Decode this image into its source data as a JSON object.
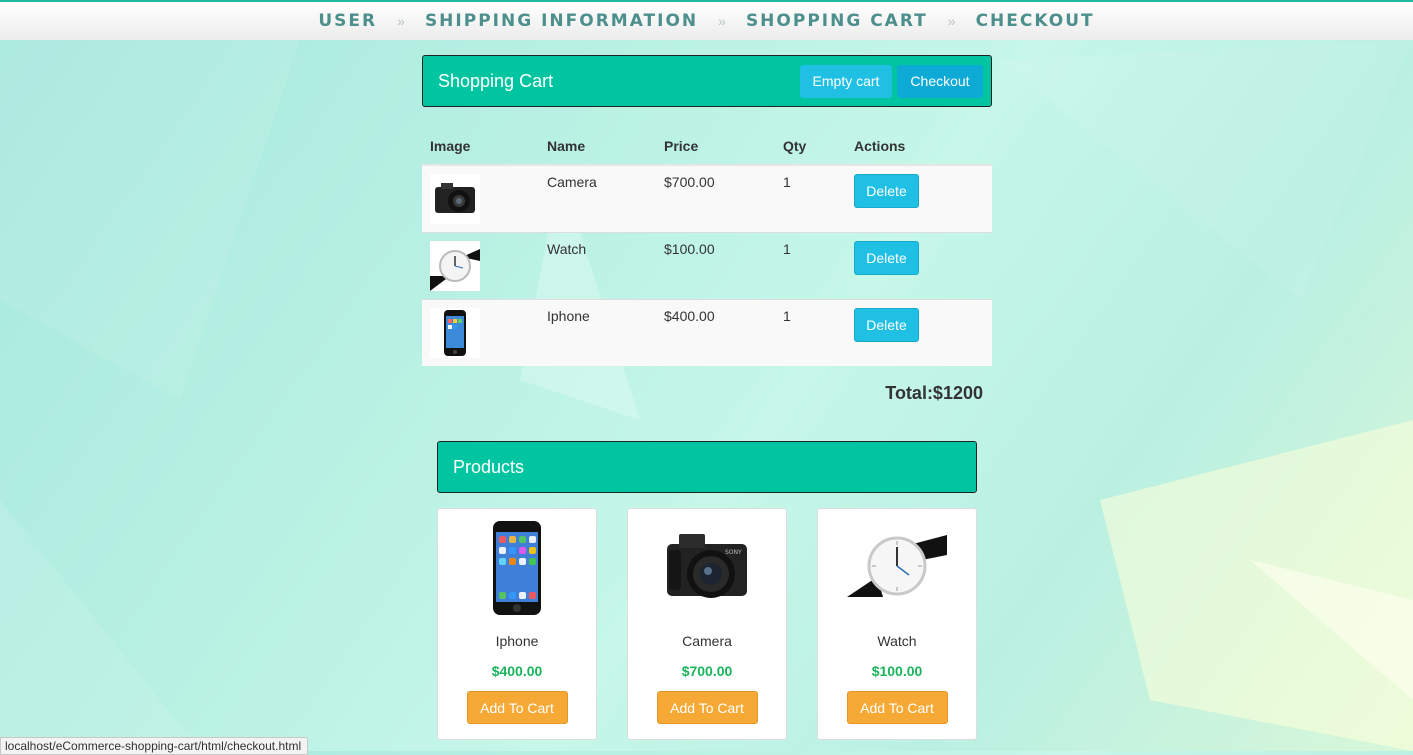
{
  "nav": {
    "items": [
      "USER",
      "SHIPPING INFORMATION",
      "SHOPPING CART",
      "CHECKOUT"
    ],
    "separator": "»"
  },
  "cart": {
    "title": "Shopping Cart",
    "empty_label": "Empty cart",
    "checkout_label": "Checkout",
    "columns": [
      "Image",
      "Name",
      "Price",
      "Qty",
      "Actions"
    ],
    "rows": [
      {
        "name": "Camera",
        "price": "$700.00",
        "qty": "1",
        "action": "Delete",
        "icon": "camera-icon"
      },
      {
        "name": "Watch",
        "price": "$100.00",
        "qty": "1",
        "action": "Delete",
        "icon": "watch-icon"
      },
      {
        "name": "Iphone",
        "price": "$400.00",
        "qty": "1",
        "action": "Delete",
        "icon": "phone-icon"
      }
    ],
    "total": "Total:$1200"
  },
  "products": {
    "title": "Products",
    "items": [
      {
        "name": "Iphone",
        "price": "$400.00",
        "button": "Add To Cart",
        "icon": "phone-icon"
      },
      {
        "name": "Camera",
        "price": "$700.00",
        "button": "Add To Cart",
        "icon": "camera-icon"
      },
      {
        "name": "Watch",
        "price": "$100.00",
        "button": "Add To Cart",
        "icon": "watch-icon"
      }
    ]
  },
  "status_url": "localhost/eCommerce-shopping-cart/html/checkout.html",
  "colors": {
    "panel": "#00c5a0",
    "info_button": "#20c0e4",
    "add_button": "#f7a935",
    "price_green": "#1ab45a"
  }
}
